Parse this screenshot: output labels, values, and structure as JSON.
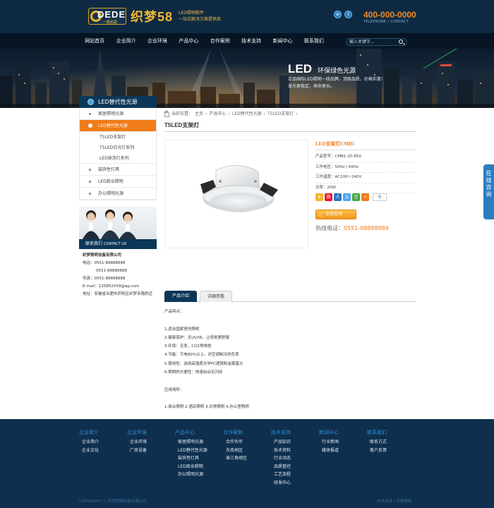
{
  "header": {
    "logo_word": "DEDE",
    "logo_sub": "一概如驱",
    "brand": "织梦58",
    "slogan_line1": "LED照明配件",
    "slogan_line2": "一站式解决方案提供商",
    "social": [
      "sina-weibo",
      "tencent-weibo"
    ],
    "phone": "400-000-0000",
    "phone_sub": "TELEPHONE / CONTACT"
  },
  "nav": {
    "items": [
      "网站首页",
      "企业简介",
      "企业环境",
      "产品中心",
      "合作案例",
      "技术支持",
      "新闻中心",
      "联系我们"
    ],
    "search_placeholder": "输入关键字..."
  },
  "banner": {
    "big": "LED",
    "side": "环保绿色光源",
    "line1": "正品国际LED照明一线品牌，顶级品质，价格实惠！",
    "line2": "发光更稳定，寿命更长。"
  },
  "sidebar": {
    "title": "LED替代性光源",
    "items": [
      {
        "label": "家居照明光源"
      },
      {
        "label": "LED替代性光源"
      },
      {
        "label": "T5LED支架灯"
      },
      {
        "label": "T5LED日光灯系列"
      },
      {
        "label": "LED球泡灯系列"
      },
      {
        "label": "装饰性灯具"
      },
      {
        "label": "LED商业照明"
      },
      {
        "label": "办公照明光源"
      }
    ]
  },
  "contact": {
    "head": "联系我们",
    "head_en": "CONTACT US",
    "company": "织梦照明设备有限公司",
    "tel_label": "电话：",
    "tel1": "0551-88888888",
    "tel2": "0551-88888888",
    "fax": "传真：0551-88888888",
    "email": "E-mail：125852439@qq.com",
    "address": "地址：安徽省合肥市庐阳区织梦寺路附近"
  },
  "breadcrumb": {
    "prefix": "当前位置：",
    "items": [
      "主页",
      "产品中心",
      "LED替代性光源",
      "T5LED支架灯"
    ]
  },
  "product": {
    "page_title": "T5LED支架灯",
    "name": "LED支架灯CMB1",
    "rows": [
      "产品型号：CMB1-20-850",
      "工作电压：50Hz / 60Hz",
      "工作温度：AC100～240V",
      "功率：20W"
    ],
    "share_count": "0",
    "chat_label": "在线咨询",
    "hotline_label": "热线电话：",
    "hotline": "0551-88888888"
  },
  "tabs": [
    "产品介绍",
    "详细参数"
  ],
  "content": {
    "lines": [
      "产品特点：",
      "",
      "1.适合国家室内照明",
      "2.健康保护：无UV/IR，让视觉更舒服",
      "3.环保：无汞，CO2零排放",
      "4.节能：节电80%以上，对空调制冷的负荷",
      "5.使用性：选用高强度光学PC透镜和金属基分",
      "6.照明的方便性：快速启动无闪烁",
      "",
      "应用场所：",
      "",
      "1.商业照明 2.酒店照明 3.日常照明 4.办公室照明"
    ]
  },
  "float_tab": "在线咨询",
  "footer": {
    "columns": [
      {
        "head": "企业简介",
        "links": [
          "企业简介",
          "企业文化"
        ]
      },
      {
        "head": "企业环境",
        "links": [
          "企业环境",
          "厂房设备"
        ]
      },
      {
        "head": "产品中心",
        "links": [
          "家居照明光源",
          "LED替代性光源",
          "装饰性灯具",
          "LED商业照明",
          "办公照明光源"
        ]
      },
      {
        "head": "合作案例",
        "links": [
          "合作伙伴",
          "东南地区",
          "珠三角地区"
        ]
      },
      {
        "head": "技术支持",
        "links": [
          "产品知识",
          "技术资料",
          "行业动态",
          "品质管控",
          "工艺流程",
          "研发中心"
        ]
      },
      {
        "head": "新闻中心",
        "links": [
          "行业新闻",
          "媒体报道"
        ]
      },
      {
        "head": "联系我们",
        "links": [
          "联系方式",
          "客户反馈"
        ]
      }
    ],
    "copyright": "COPYRIGHT © 织梦照明设备有限公司",
    "right": "技术支持 | 织梦模板"
  }
}
